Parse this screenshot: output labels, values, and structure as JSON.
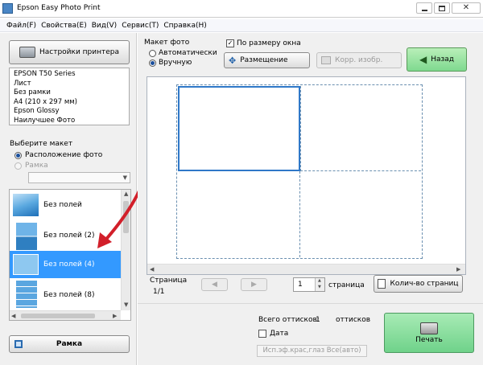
{
  "window": {
    "title": "Epson Easy Photo Print"
  },
  "menu": [
    "Файл(F)",
    "Свойства(E)",
    "Вид(V)",
    "Сервис(T)",
    "Справка(H)"
  ],
  "printer": {
    "settings_label": "Настройки принтера",
    "info": [
      "EPSON T50 Series",
      "Лист",
      "Без рамки",
      "A4 (210 x 297 мм)",
      "Epson Glossy",
      "Наилучшее Фото"
    ]
  },
  "layout_select": {
    "title": "Выберите макет",
    "option_layout": "Расположение фото",
    "option_frame": "Рамка",
    "items": [
      {
        "label": "Без полей",
        "selected": false
      },
      {
        "label": "Без полей (2)",
        "selected": false
      },
      {
        "label": "Без полей (4)",
        "selected": true
      },
      {
        "label": "Без полей (8)",
        "selected": false
      }
    ]
  },
  "frame_button": "Рамка",
  "photo_layout": {
    "title": "Макет фото",
    "auto": "Автоматически",
    "manual": "Вручную",
    "fit_window": "По размеру окна",
    "placement": "Размещение",
    "correct": "Корр. изобр.",
    "back": "Назад"
  },
  "page_nav": {
    "label": "Страница",
    "value": "1/1"
  },
  "pages": {
    "count": "1",
    "label": "страница",
    "count_button": "Колич-во страниц"
  },
  "summary": {
    "total_label": "Всего оттисков:",
    "total_value": "1",
    "unit": "оттисков",
    "date": "Дата",
    "effects": "Исп.эф.крас,глаз Все(авто)"
  },
  "print_button": "Печать",
  "colors": {
    "accent": "#3399ff",
    "print_green": "#7fd98f",
    "back_green": "#8fd88f",
    "arrow": "#d21f2a"
  }
}
